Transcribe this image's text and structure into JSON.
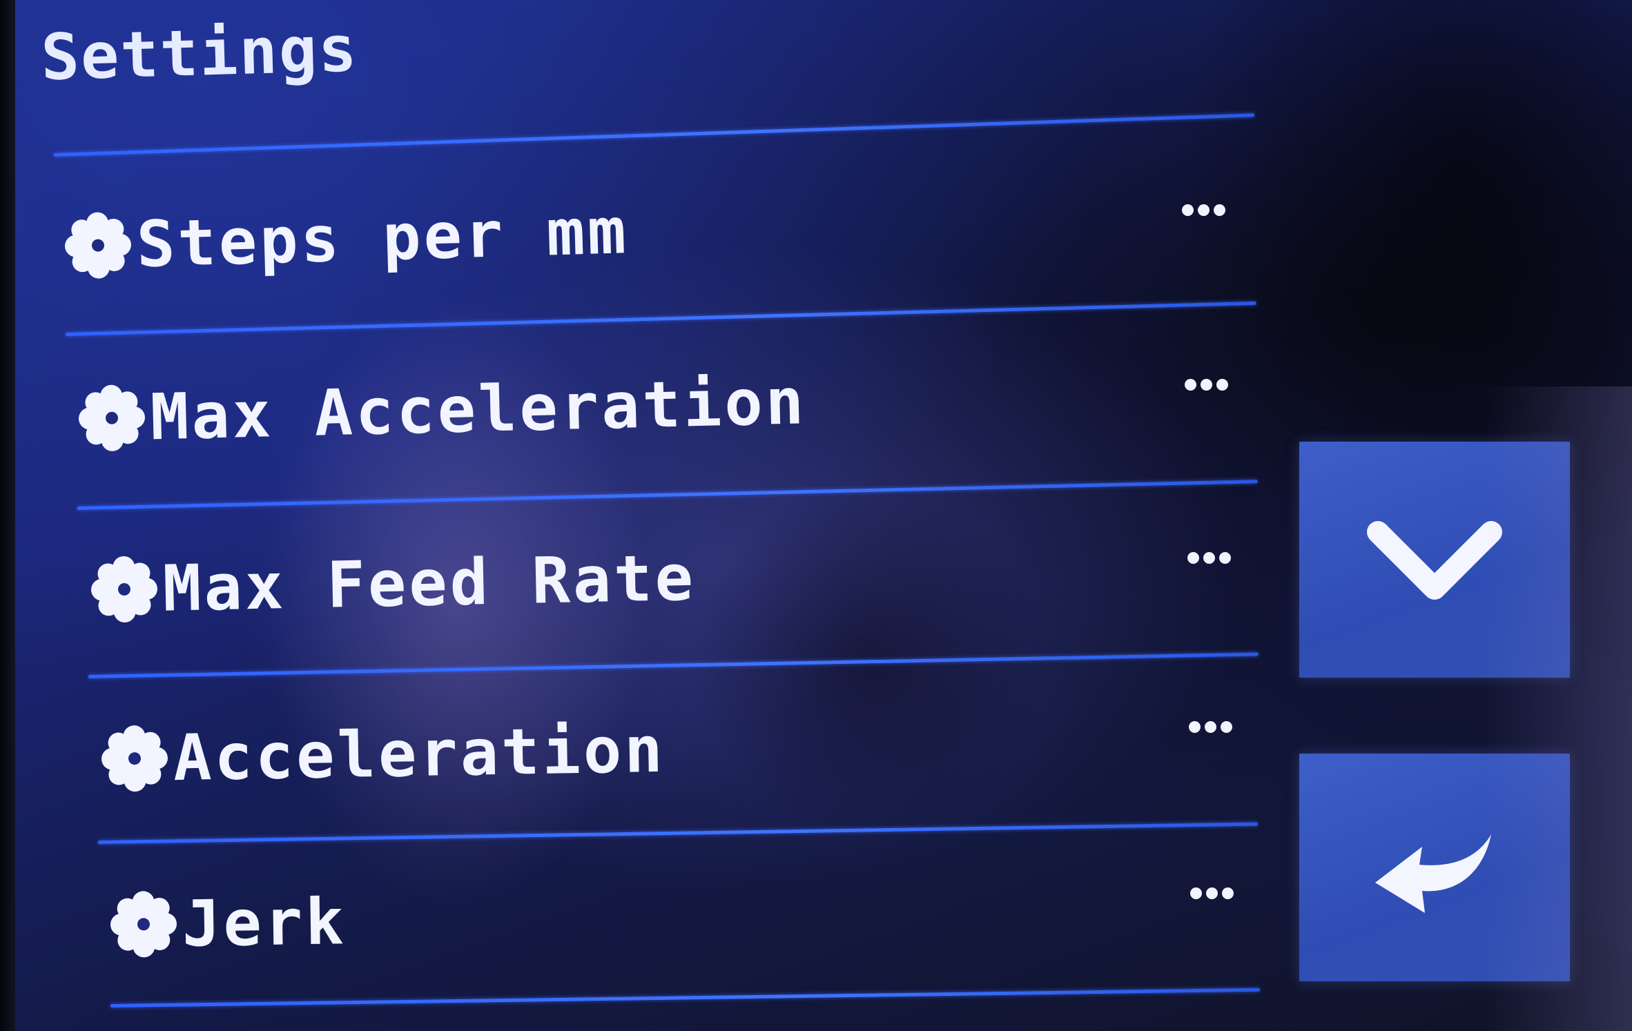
{
  "screen": {
    "title": "Settings"
  },
  "menu": {
    "items": [
      {
        "label": "Steps per mm",
        "icon": "gear-icon",
        "more": "more-icon"
      },
      {
        "label": "Max Acceleration",
        "icon": "gear-icon",
        "more": "more-icon"
      },
      {
        "label": "Max Feed Rate",
        "icon": "gear-icon",
        "more": "more-icon"
      },
      {
        "label": "Acceleration",
        "icon": "gear-icon",
        "more": "more-icon"
      },
      {
        "label": "Jerk",
        "icon": "gear-icon",
        "more": "more-icon"
      }
    ]
  },
  "side_buttons": {
    "down": {
      "icon": "chevron-down-icon"
    },
    "back": {
      "icon": "back-arrow-icon"
    }
  },
  "colors": {
    "background": "#1b2678",
    "divider": "#3f74ff",
    "text": "#f2f5ff",
    "button": "#3250b3"
  }
}
